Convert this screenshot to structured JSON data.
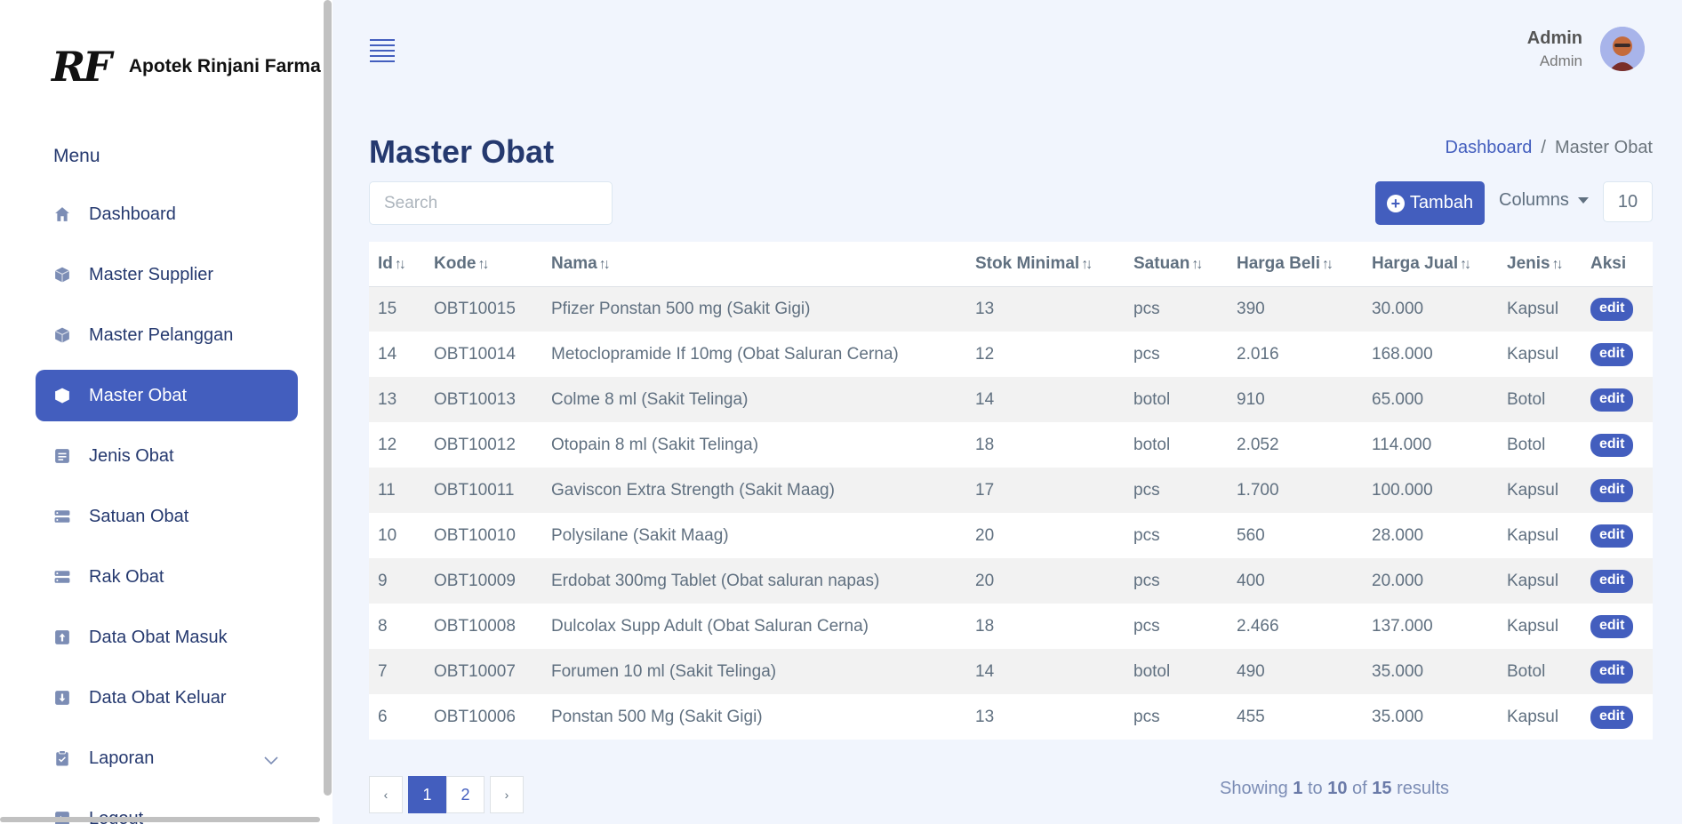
{
  "brand": {
    "mark": "RF",
    "name": "Apotek Rinjani Farma"
  },
  "sidebar": {
    "menu_title": "Menu",
    "items": [
      {
        "label": "Dashboard",
        "icon": "house-icon"
      },
      {
        "label": "Master Supplier",
        "icon": "box-icon"
      },
      {
        "label": "Master Pelanggan",
        "icon": "box-icon"
      },
      {
        "label": "Master Obat",
        "icon": "box-icon",
        "active": true
      },
      {
        "label": "Jenis Obat",
        "icon": "list-icon"
      },
      {
        "label": "Satuan Obat",
        "icon": "server-icon"
      },
      {
        "label": "Rak Obat",
        "icon": "server-icon"
      },
      {
        "label": "Data Obat Masuk",
        "icon": "arrow-up-square-icon"
      },
      {
        "label": "Data Obat Keluar",
        "icon": "arrow-down-square-icon"
      },
      {
        "label": "Laporan",
        "icon": "clipboard-icon",
        "has_submenu": true
      },
      {
        "label": "Logout",
        "icon": "logout-icon"
      }
    ]
  },
  "header": {
    "user_name": "Admin",
    "user_role": "Admin"
  },
  "page": {
    "title": "Master Obat",
    "breadcrumb": {
      "home": "Dashboard",
      "separator": "/",
      "current": "Master Obat"
    }
  },
  "toolbar": {
    "search_placeholder": "Search",
    "add_label": "Tambah",
    "columns_label": "Columns",
    "per_page": "10"
  },
  "table": {
    "headers": [
      "Id",
      "Kode",
      "Nama",
      "Stok Minimal",
      "Satuan",
      "Harga Beli",
      "Harga Jual",
      "Jenis",
      "Aksi"
    ],
    "sort_glyph": "↑↓",
    "action_label": "edit",
    "rows": [
      [
        "15",
        "OBT10015",
        "Pfizer Ponstan 500 mg (Sakit Gigi)",
        "13",
        "pcs",
        "390",
        "30.000",
        "Kapsul"
      ],
      [
        "14",
        "OBT10014",
        "Metoclopramide If 10mg (Obat Saluran Cerna)",
        "12",
        "pcs",
        "2.016",
        "168.000",
        "Kapsul"
      ],
      [
        "13",
        "OBT10013",
        "Colme 8 ml (Sakit Telinga)",
        "14",
        "botol",
        "910",
        "65.000",
        "Botol"
      ],
      [
        "12",
        "OBT10012",
        "Otopain 8 ml (Sakit Telinga)",
        "18",
        "botol",
        "2.052",
        "114.000",
        "Botol"
      ],
      [
        "11",
        "OBT10011",
        "Gaviscon Extra Strength (Sakit Maag)",
        "17",
        "pcs",
        "1.700",
        "100.000",
        "Kapsul"
      ],
      [
        "10",
        "OBT10010",
        "Polysilane (Sakit Maag)",
        "20",
        "pcs",
        "560",
        "28.000",
        "Kapsul"
      ],
      [
        "9",
        "OBT10009",
        "Erdobat 300mg Tablet (Obat saluran napas)",
        "20",
        "pcs",
        "400",
        "20.000",
        "Kapsul"
      ],
      [
        "8",
        "OBT10008",
        "Dulcolax Supp Adult (Obat Saluran Cerna)",
        "18",
        "pcs",
        "2.466",
        "137.000",
        "Kapsul"
      ],
      [
        "7",
        "OBT10007",
        "Forumen 10 ml (Sakit Telinga)",
        "14",
        "botol",
        "490",
        "35.000",
        "Botol"
      ],
      [
        "6",
        "OBT10006",
        "Ponstan 500 Mg (Sakit Gigi)",
        "13",
        "pcs",
        "455",
        "35.000",
        "Kapsul"
      ]
    ]
  },
  "pagination": {
    "prev": "‹",
    "next": "›",
    "pages": [
      "1",
      "2"
    ],
    "current": "1"
  },
  "summary": {
    "prefix": "Showing",
    "from": "1",
    "to_word": "to",
    "to": "10",
    "of_word": "of",
    "total": "15",
    "suffix": "results"
  },
  "colors": {
    "primary": "#435ebe",
    "text": "#25396f",
    "muted": "#607080",
    "background": "#f1f5fd"
  }
}
